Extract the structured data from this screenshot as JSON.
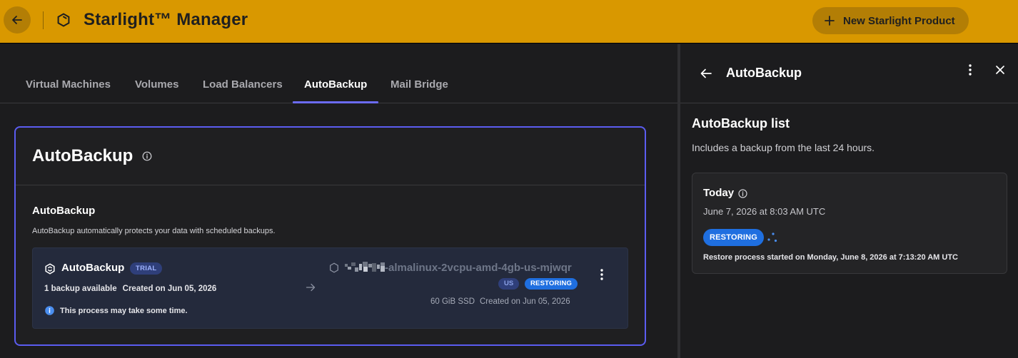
{
  "app": {
    "title": "Starlight™ Manager",
    "new_button_label": "New Starlight Product"
  },
  "tabs": [
    {
      "label": "Virtual Machines",
      "active": false
    },
    {
      "label": "Volumes",
      "active": false
    },
    {
      "label": "Load Balancers",
      "active": false
    },
    {
      "label": "AutoBackup",
      "active": true
    },
    {
      "label": "Mail Bridge",
      "active": false
    }
  ],
  "card": {
    "title": "AutoBackup",
    "section_title": "AutoBackup",
    "section_desc": "AutoBackup automatically protects your data with scheduled backups.",
    "backup": {
      "name": "AutoBackup",
      "badge": "TRIAL",
      "count": "1 backup available",
      "created": "Created on Jun 05, 2026",
      "note": "This process may take some time."
    },
    "vm": {
      "name": "-almalinux-2vcpu-amd-4gb-us-mjwqr",
      "region": "US",
      "status": "RESTORING",
      "disk": "60 GiB SSD",
      "created": "Created on Jun 05, 2026"
    }
  },
  "panel": {
    "title": "AutoBackup",
    "list_title": "AutoBackup list",
    "list_desc": "Includes a backup from the last 24 hours.",
    "entry": {
      "title": "Today",
      "date": "June 7, 2026 at 8:03 AM UTC",
      "status": "RESTORING",
      "detail": "Restore process started on Monday, June 8, 2026 at 7:13:20 AM UTC"
    }
  },
  "colors": {
    "topbar": "#d99800",
    "accent": "#5b5cf0",
    "status_blue": "#1f6fe0"
  }
}
